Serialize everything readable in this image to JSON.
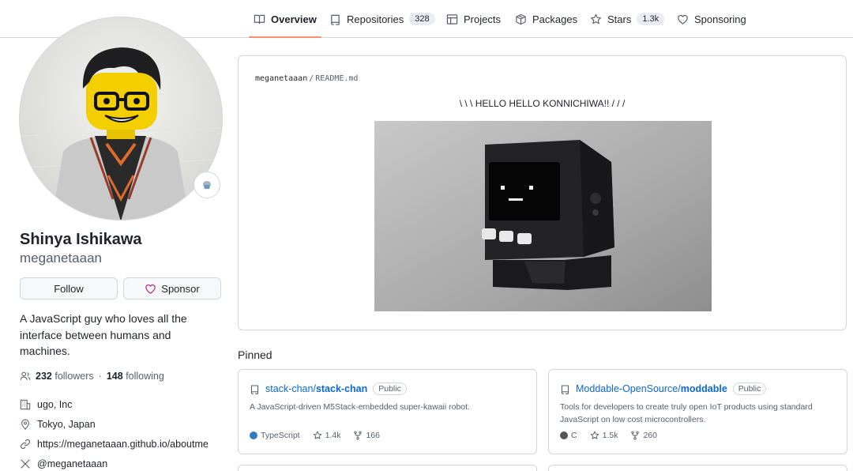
{
  "nav": {
    "tabs": [
      {
        "label": "Overview",
        "count": null,
        "active": true,
        "icon": "book-icon"
      },
      {
        "label": "Repositories",
        "count": "328",
        "icon": "repo-icon"
      },
      {
        "label": "Projects",
        "count": null,
        "icon": "table-icon"
      },
      {
        "label": "Packages",
        "count": null,
        "icon": "package-icon"
      },
      {
        "label": "Stars",
        "count": "1.3k",
        "icon": "star-icon"
      },
      {
        "label": "Sponsoring",
        "count": null,
        "icon": "heart-icon"
      }
    ]
  },
  "profile": {
    "fullname": "Shinya Ishikawa",
    "login": "meganetaaan",
    "status_icon": "cupcake-icon",
    "follow_label": "Follow",
    "sponsor_label": "Sponsor",
    "bio": "A JavaScript guy who loves all the interface between humans and machines.",
    "followers_count": "232",
    "followers_label": "followers",
    "separator": "·",
    "following_count": "148",
    "following_label": "following",
    "company": "ugo, Inc",
    "location": "Tokyo, Japan",
    "website": "https://meganetaaan.github.io/aboutme",
    "twitter": "@meganetaaan"
  },
  "readme": {
    "owner": "meganetaaan",
    "separator": "/",
    "file": "README.md",
    "heading": "\\ \\ \\ HELLO HELLO KONNICHIWA!! / / /"
  },
  "pinned": {
    "title": "Pinned",
    "repos": [
      {
        "owner": "stack-chan",
        "slash": "/",
        "name": "stack-chan",
        "visibility": "Public",
        "description": "A JavaScript-driven M5Stack-embedded super-kawaii robot.",
        "language": "TypeScript",
        "language_color": "#3178c6",
        "stars": "1.4k",
        "forks": "166"
      },
      {
        "owner": "Moddable-OpenSource",
        "slash": "/",
        "name": "moddable",
        "visibility": "Public",
        "description": "Tools for developers to create truly open IoT products using standard JavaScript on low cost microcontrollers.",
        "language": "C",
        "language_color": "#555555",
        "stars": "1.5k",
        "forks": "260"
      }
    ]
  },
  "colors": {
    "accent_underline": "#fd8c73",
    "link": "#0969da",
    "sponsor_heart": "#bf3989"
  }
}
